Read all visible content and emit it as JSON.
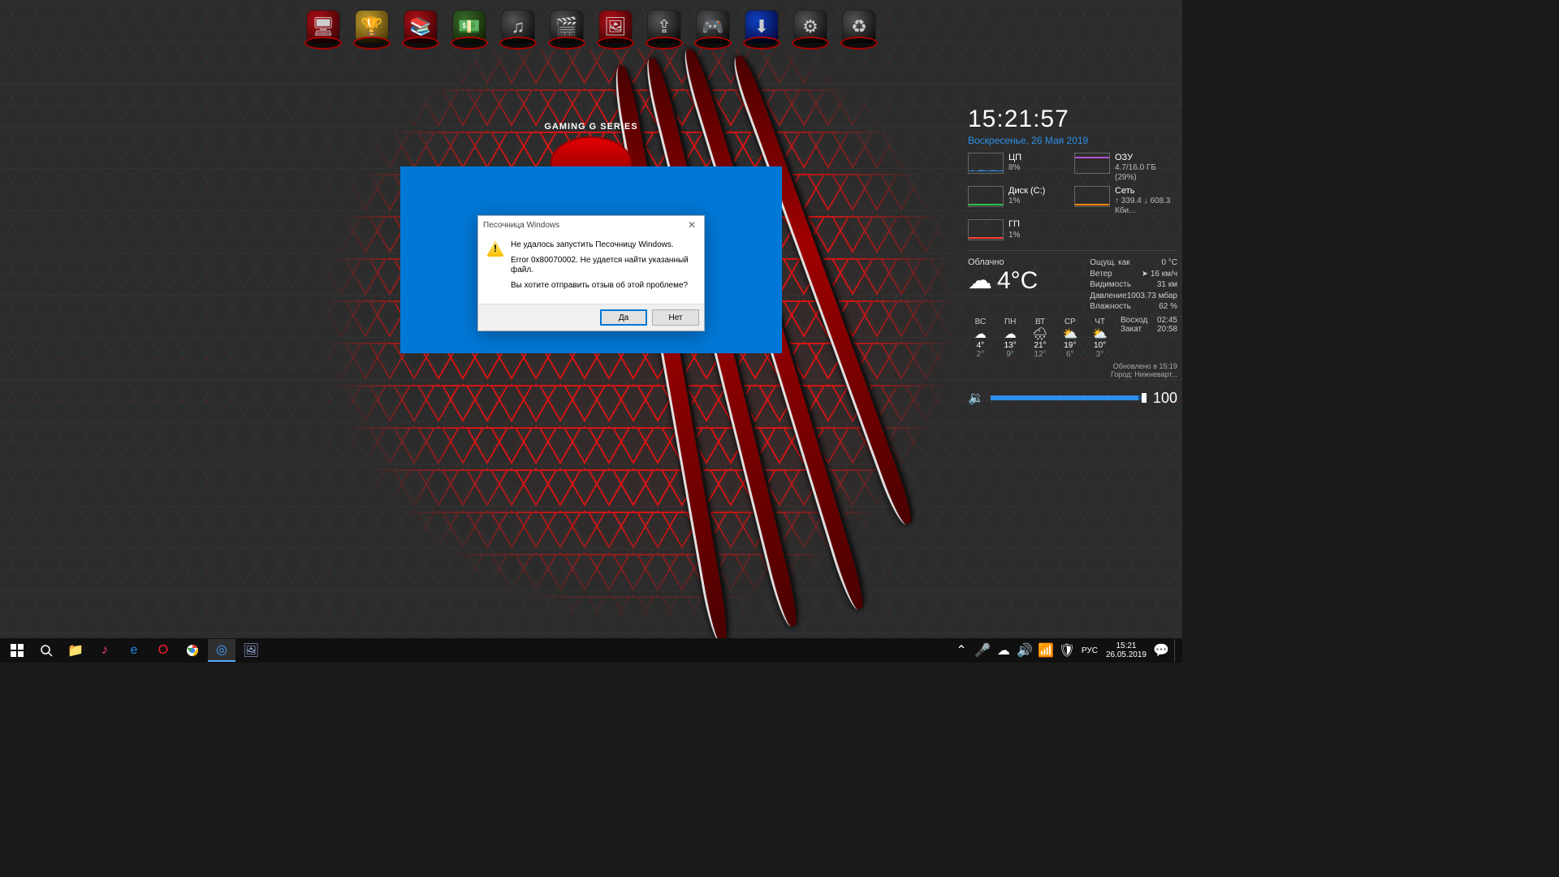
{
  "wallpaper": {
    "badge_text": "GAMING G SERIES"
  },
  "dock": {
    "items": [
      {
        "name": "monitor",
        "accent": "red",
        "glyph": "🖥"
      },
      {
        "name": "trophy",
        "accent": "gold",
        "glyph": "🏆"
      },
      {
        "name": "books",
        "accent": "red",
        "glyph": "📚"
      },
      {
        "name": "money",
        "accent": "green",
        "glyph": "💵"
      },
      {
        "name": "music",
        "accent": "",
        "glyph": "♫"
      },
      {
        "name": "movies",
        "accent": "",
        "glyph": "🎬"
      },
      {
        "name": "photos",
        "accent": "red",
        "glyph": "🖼"
      },
      {
        "name": "share",
        "accent": "",
        "glyph": "⇪"
      },
      {
        "name": "games",
        "accent": "",
        "glyph": "🎮"
      },
      {
        "name": "download",
        "accent": "blue",
        "glyph": "⬇"
      },
      {
        "name": "settings",
        "accent": "",
        "glyph": "⚙"
      },
      {
        "name": "recycle",
        "accent": "",
        "glyph": "♻"
      }
    ]
  },
  "dialog": {
    "title": "Песочница Windows",
    "line1": "Не удалось запустить Песочницу Windows.",
    "line2": "Error 0x80070002. Не удается найти указанный файл.",
    "line3": "Вы хотите отправить отзыв об этой проблеме?",
    "yes": "Да",
    "no": "Нет"
  },
  "clock": {
    "time": "15:21:57",
    "date": "Воскресенье, 26 Мая 2019"
  },
  "metrics": {
    "cpu": {
      "label": "ЦП",
      "value": "8%"
    },
    "ram": {
      "label": "ОЗУ",
      "value": "4.7/16.0 ГБ (29%)"
    },
    "disk": {
      "label": "Диск (C:)",
      "value": "1%"
    },
    "net": {
      "label": "Сеть",
      "value": "↑ 339.4 ↓ 608.3 Кби..."
    },
    "gpu": {
      "label": "ГП",
      "value": "1%"
    }
  },
  "weather": {
    "cond": "Облачно",
    "temp": "4°C",
    "feels_label": "Ощущ. как",
    "feels": "0 °C",
    "wind_label": "Ветер",
    "wind": "➤ 16 км/ч",
    "vis_label": "Видимость",
    "vis": "31 км",
    "press_label": "Давление",
    "press": "1003.73 мбар",
    "hum_label": "Влажность",
    "hum": "62 %",
    "days": [
      {
        "d": "ВС",
        "ic": "☁",
        "hi": "4°",
        "lo": "2°"
      },
      {
        "d": "ПН",
        "ic": "☁",
        "hi": "13°",
        "lo": "9°"
      },
      {
        "d": "ВТ",
        "ic": "🌧",
        "hi": "21°",
        "lo": "12°"
      },
      {
        "d": "СР",
        "ic": "⛅",
        "hi": "19°",
        "lo": "6°"
      },
      {
        "d": "ЧТ",
        "ic": "⛅",
        "hi": "10°",
        "lo": "3°"
      }
    ],
    "sunrise_label": "Восход",
    "sunrise": "02:45",
    "sunset_label": "Закат",
    "sunset": "20:58",
    "updated": "Обновлено в 15:19",
    "city": "Город: Нижневарт..."
  },
  "volume": {
    "value": "100"
  },
  "taskbar": {
    "lang": "РУС",
    "time": "15:21",
    "date": "26.05.2019"
  }
}
